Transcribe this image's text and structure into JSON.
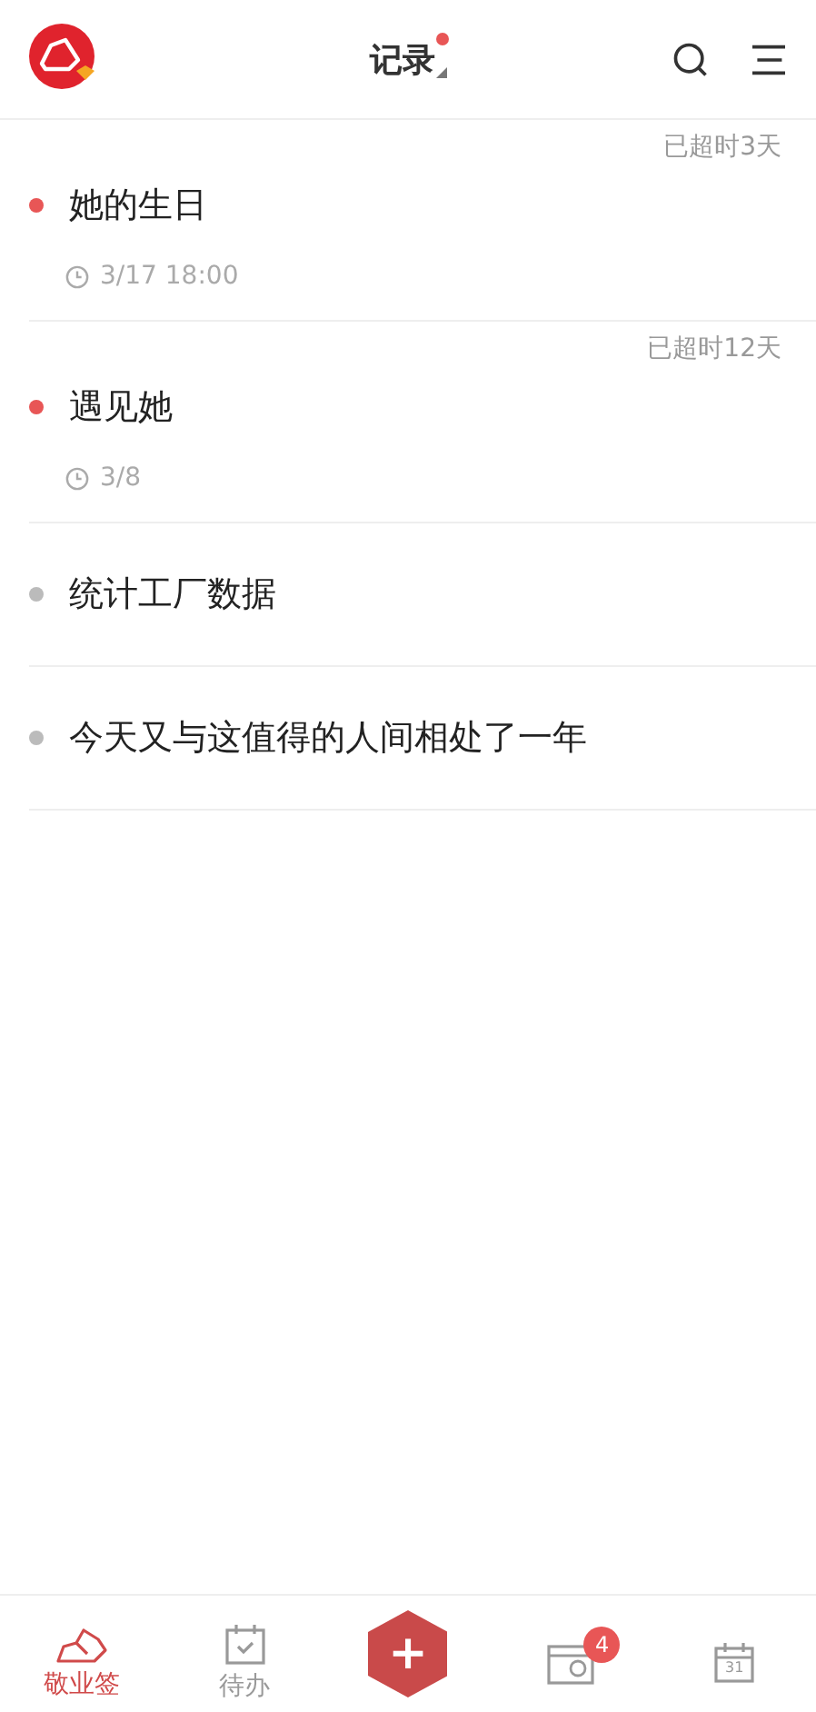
{
  "header": {
    "title": "记录",
    "has_new": true
  },
  "items": [
    {
      "title": "她的生日",
      "overdue": "已超时3天",
      "date": "3/17 18:00",
      "color": "#e85656"
    },
    {
      "title": "遇见她",
      "overdue": "已超时12天",
      "date": "3/8",
      "color": "#e85656"
    },
    {
      "title": "统计工厂数据",
      "color": "#bbbbbb"
    },
    {
      "title": "今天又与这值得的人间相处了一年",
      "color": "#bbbbbb"
    }
  ],
  "tabs": [
    {
      "kind": "notes",
      "label": "敬业签",
      "selected": true
    },
    {
      "kind": "todo",
      "label": "待办",
      "selected": false
    },
    {
      "kind": "add",
      "glyph": "+"
    },
    {
      "kind": "schedule",
      "badge": "4",
      "selected": false
    },
    {
      "kind": "calendar",
      "day": "31",
      "selected": false
    }
  ]
}
